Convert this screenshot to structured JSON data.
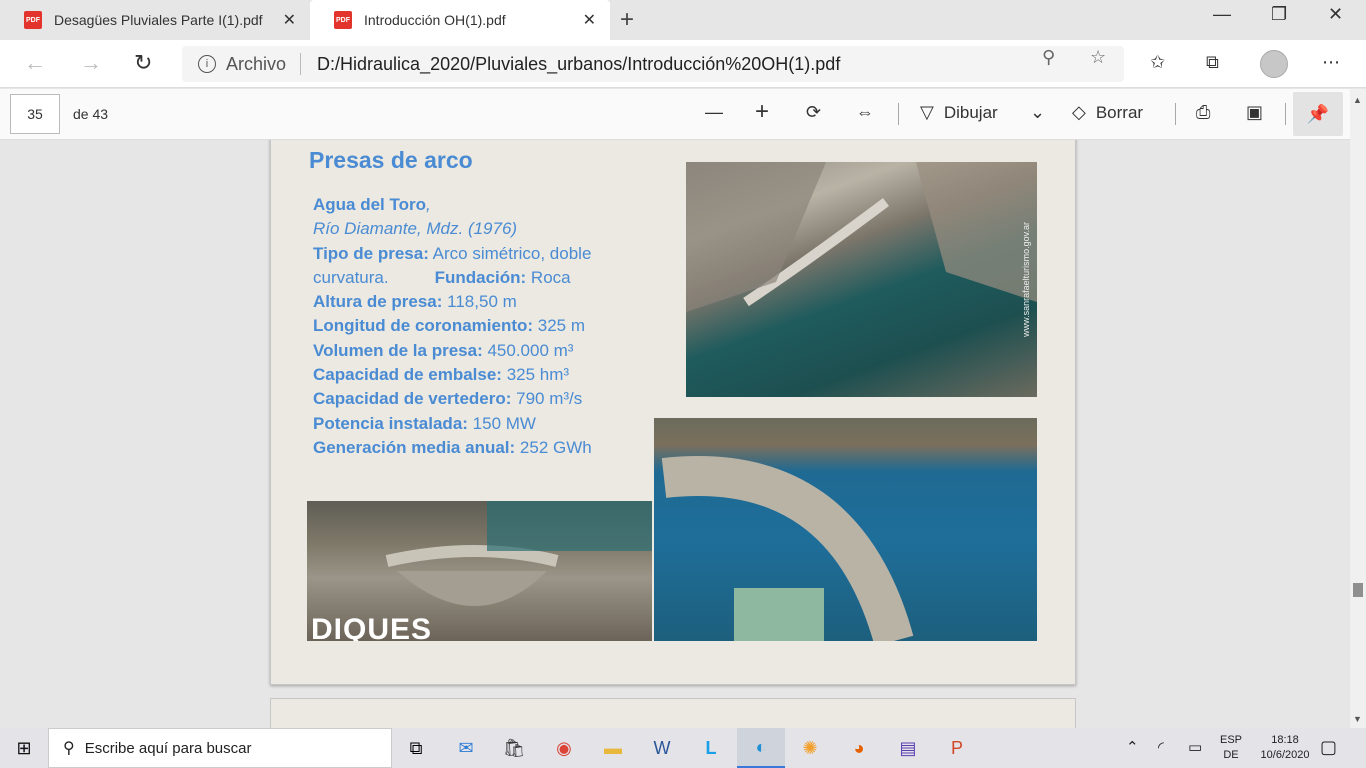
{
  "browser": {
    "tabs": [
      {
        "title": "Desagües Pluviales Parte I(1).pdf",
        "icon": "pdf-icon",
        "active": false
      },
      {
        "title": "Introducción OH(1).pdf",
        "icon": "pdf-icon",
        "active": true
      }
    ],
    "pdf_badge": "PDF",
    "close_glyph": "✕",
    "new_tab_glyph": "+",
    "window": {
      "minimize": "—",
      "maximize": "❐",
      "close": "✕"
    },
    "address": {
      "scheme_label": "Archivo",
      "url": "D:/Hidraulica_2020/Pluviales_urbanos/Introducción%20OH(1).pdf"
    }
  },
  "pdf_toolbar": {
    "page_number": "35",
    "page_total": "de 43",
    "draw_label": "Dibujar",
    "erase_label": "Borrar"
  },
  "slide": {
    "title": "Presas de arco",
    "name": "Agua del Toro",
    "name_suffix": ",",
    "location": "Río Diamante, Mdz. (1976)",
    "rows": [
      {
        "label": "Tipo de presa:",
        "value": " Arco simétrico, doble"
      },
      {
        "label": "",
        "value": "curvatura."
      },
      {
        "label": "Altura de presa:",
        "value": " 118,50 m"
      },
      {
        "label": "Longitud de coronamiento:",
        "value": " 325 m"
      },
      {
        "label": "Volumen de la presa:",
        "value": " 450.000 m³"
      },
      {
        "label": "Capacidad de embalse:",
        "value": " 325 hm³"
      },
      {
        "label": "Capacidad de vertedero:",
        "value": " 790 m³/s"
      },
      {
        "label": "Potencia instalada:",
        "value": " 150 MW"
      },
      {
        "label": "Generación media anual:",
        "value": " 252 GWh"
      }
    ],
    "foundation_label": "Fundación:",
    "foundation_value": " Roca",
    "photo_watermark": "www.sanrafaelturismo.gov.ar",
    "photo_caption": "DIQUES"
  },
  "taskbar": {
    "search_placeholder": "Escribe aquí para buscar",
    "language": "ESP",
    "language_sub": "DE",
    "time": "18:18",
    "date": "10/6/2020"
  }
}
